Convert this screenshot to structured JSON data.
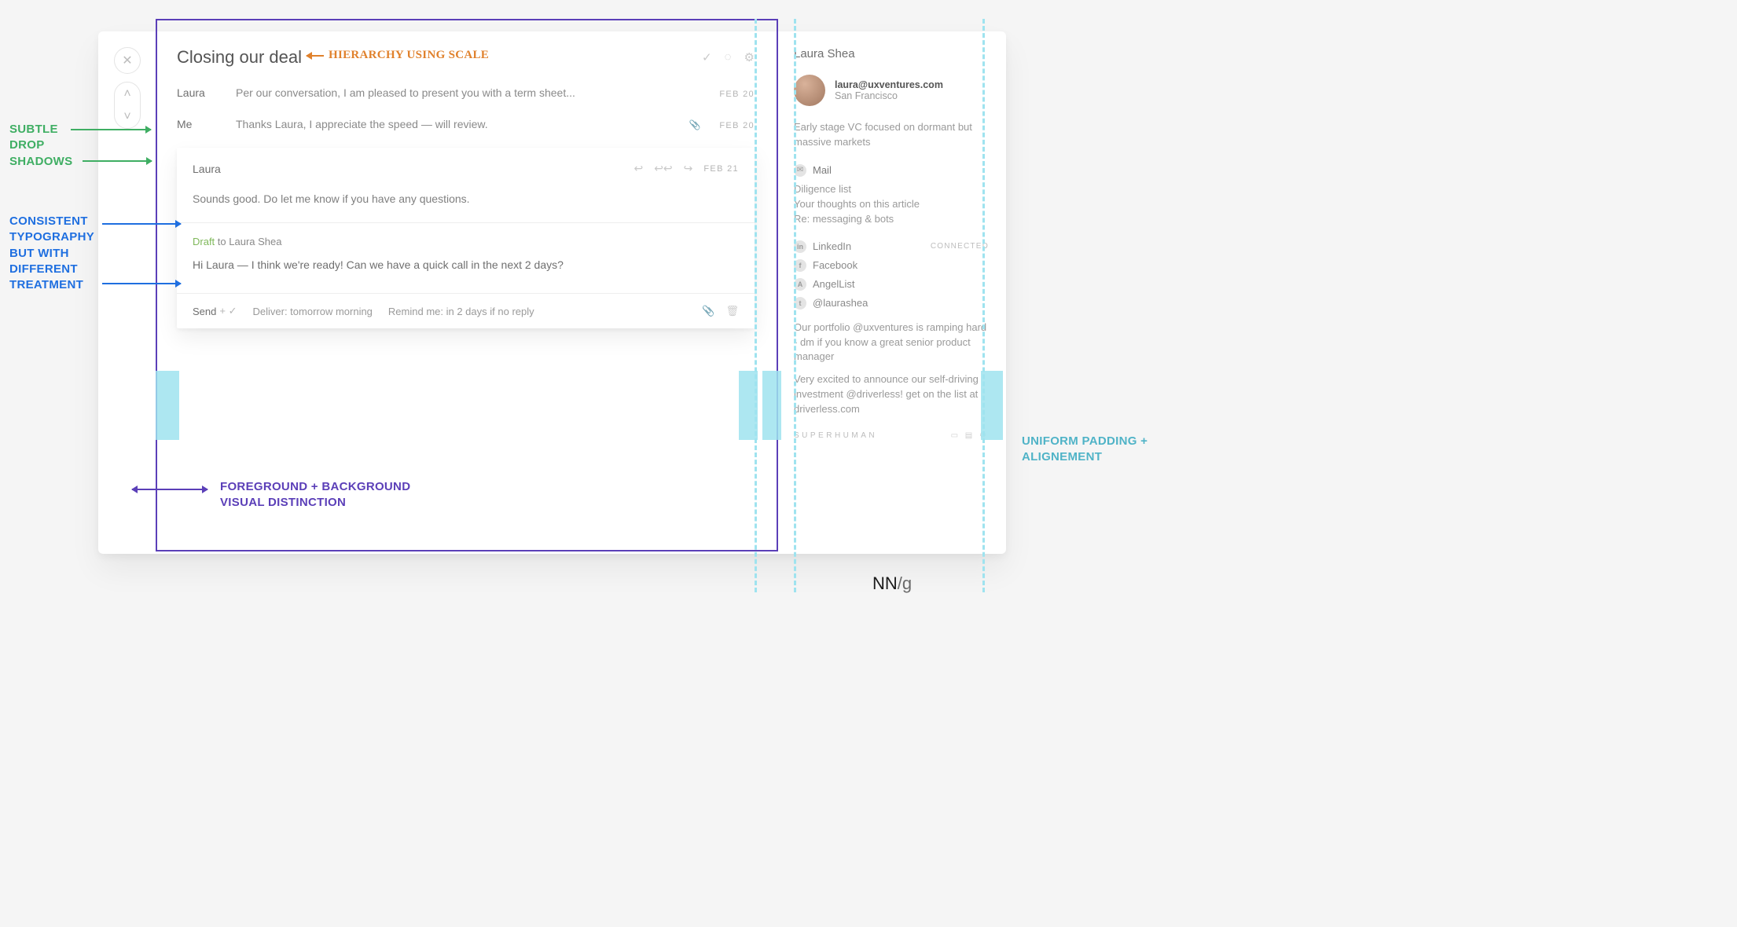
{
  "annotations": {
    "hierarchy": "HIERARCHY USING SCALE",
    "shadows_l1": "SUBTLE",
    "shadows_l2": "DROP",
    "shadows_l3": "SHADOWS",
    "typo_l1": "CONSISTENT",
    "typo_l2": "TYPOGRAPHY",
    "typo_l3": "BUT WITH",
    "typo_l4": "DIFFERENT",
    "typo_l5": "TREATMENT",
    "fgbg_l1": "FOREGROUND + BACKGROUND",
    "fgbg_l2": "VISUAL DISTINCTION",
    "padding_l1": "UNIFORM PADDING +",
    "padding_l2": "ALIGNEMENT"
  },
  "attribution": {
    "nn": "NN",
    "g": "/g"
  },
  "app": {
    "title": "Closing our deal",
    "title_actions": {
      "check": "✓",
      "clock": "◌",
      "gear": "⚙"
    },
    "messages": [
      {
        "who": "Laura",
        "preview": "Per our conversation, I am pleased to present you with a term sheet...",
        "date": "FEB 20",
        "has_attach": false
      },
      {
        "who": "Me",
        "preview": "Thanks Laura, I appreciate the speed — will review.",
        "date": "FEB 20",
        "has_attach": true
      }
    ],
    "open_message": {
      "who": "Laura",
      "date": "FEB 21",
      "actions": {
        "reply": "↩",
        "reply_all": "↩↩",
        "forward": "↪"
      },
      "body": "Sounds good.  Do let me know if you have any questions."
    },
    "draft": {
      "label": "Draft",
      "to_prefix": " to ",
      "to": "Laura Shea",
      "body": "Hi Laura — I think we're ready! Can we have a quick call in the next 2 days?"
    },
    "send_bar": {
      "send": "Send",
      "send_suffix": "+ ✓",
      "deliver": "Deliver: tomorrow morning",
      "remind": "Remind me: in 2 days if no reply",
      "attach_glyph": "📎",
      "trash_glyph": "🗑"
    }
  },
  "sidebar": {
    "name": "Laura Shea",
    "email": "laura@uxventures.com",
    "location": "San Francisco",
    "bio": "Early stage VC focused on dormant but massive markets",
    "mail_head": "Mail",
    "mail_items": [
      "Diligence list",
      "Your thoughts on this article",
      "Re: messaging & bots"
    ],
    "socials": [
      {
        "icon": "in",
        "label": "LinkedIn",
        "tag": "CONNECTED"
      },
      {
        "icon": "f",
        "label": "Facebook",
        "tag": ""
      },
      {
        "icon": "A",
        "label": "AngelList",
        "tag": ""
      },
      {
        "icon": "t",
        "label": "@laurashea",
        "tag": ""
      }
    ],
    "feed": [
      "Our portfolio @uxventures is ramping hard - dm if you know a great senior product manager",
      "Very excited to announce our self-driving investment @driverless! get on the list at driverless.com"
    ],
    "brand": "SUPERHUMAN",
    "brand_glyphs": "▭ ▤ ⚙"
  }
}
